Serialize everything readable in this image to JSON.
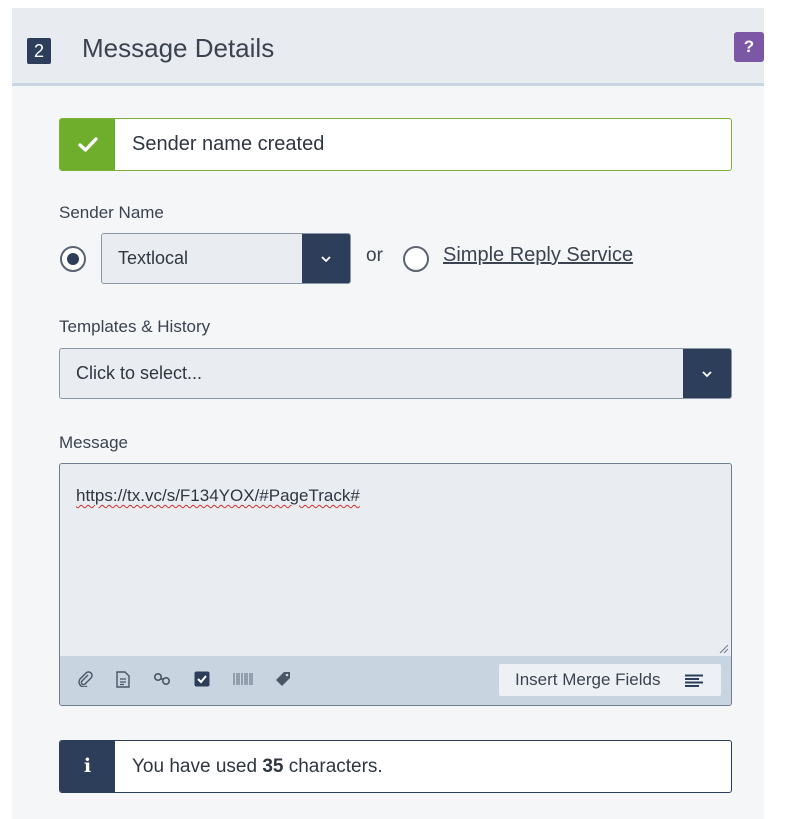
{
  "header": {
    "step_number": "2",
    "title": "Message Details",
    "help_label": "?"
  },
  "success_alert": {
    "text": "Sender name created",
    "icon": "checkmark-icon",
    "color": "#6fad2d"
  },
  "sender": {
    "label": "Sender Name",
    "selected_value": "Textlocal",
    "radio_selected": "sender-name",
    "or_text": "or",
    "alt_option_label": "Simple Reply Service"
  },
  "templates": {
    "label": "Templates & History",
    "placeholder": "Click to select..."
  },
  "message": {
    "label": "Message",
    "value": "https://tx.vc/s/F134YOX/#PageTrack#",
    "toolbar_icons": [
      "paperclip-icon",
      "document-icon",
      "link-icon",
      "checkbox-icon",
      "barcode-icon",
      "ticket-icon"
    ],
    "merge_button_label": "Insert Merge Fields"
  },
  "char_info": {
    "prefix": "You have used",
    "count": "35",
    "suffix": "characters.",
    "icon_label": "i"
  },
  "colors": {
    "navy": "#2c3e59",
    "purple": "#7b57a6",
    "success_green": "#6fad2d"
  }
}
